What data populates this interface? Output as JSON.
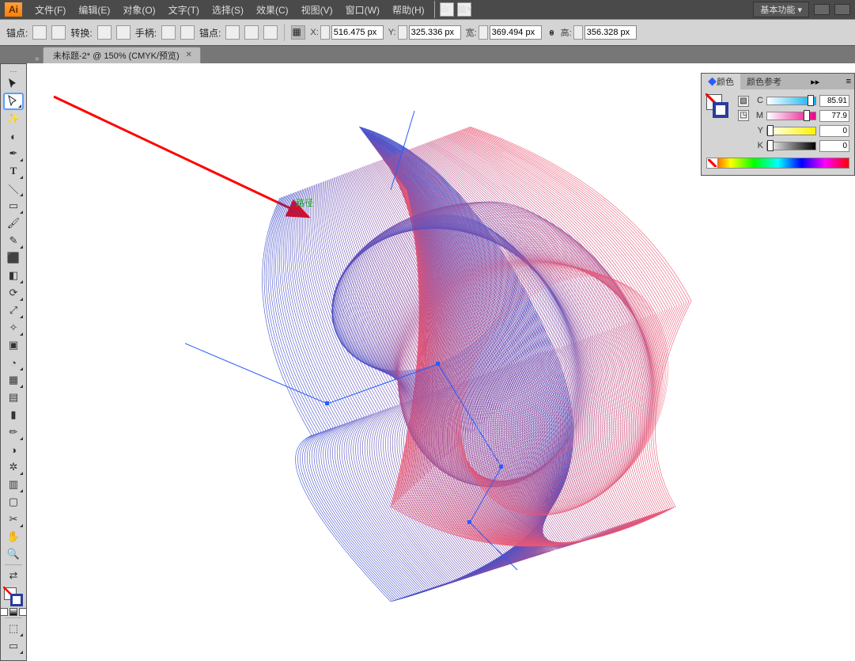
{
  "app": {
    "logo": "Ai"
  },
  "menu": {
    "items": [
      "文件(F)",
      "编辑(E)",
      "对象(O)",
      "文字(T)",
      "选择(S)",
      "效果(C)",
      "视图(V)",
      "窗口(W)",
      "帮助(H)"
    ]
  },
  "workspace": {
    "label": "基本功能"
  },
  "options": {
    "anchor_label": "锚点:",
    "convert_label": "转换:",
    "handle_label": "手柄:",
    "anchor2_label": "锚点:",
    "x_label": "X:",
    "x_value": "516.475 px",
    "y_label": "Y:",
    "y_value": "325.336 px",
    "w_label": "宽:",
    "w_value": "369.494 px",
    "h_label": "高:",
    "h_value": "356.328 px"
  },
  "document": {
    "tab_title": "未标题-2* @ 150% (CMYK/预览)"
  },
  "color_panel": {
    "tab1": "颜色",
    "tab2": "颜色参考",
    "c_label": "C",
    "c_value": "85.91",
    "m_label": "M",
    "m_value": "77.9",
    "y_label": "Y",
    "y_value": "0",
    "k_label": "K",
    "k_value": "0"
  },
  "annotation": {
    "path_label": "路径"
  }
}
